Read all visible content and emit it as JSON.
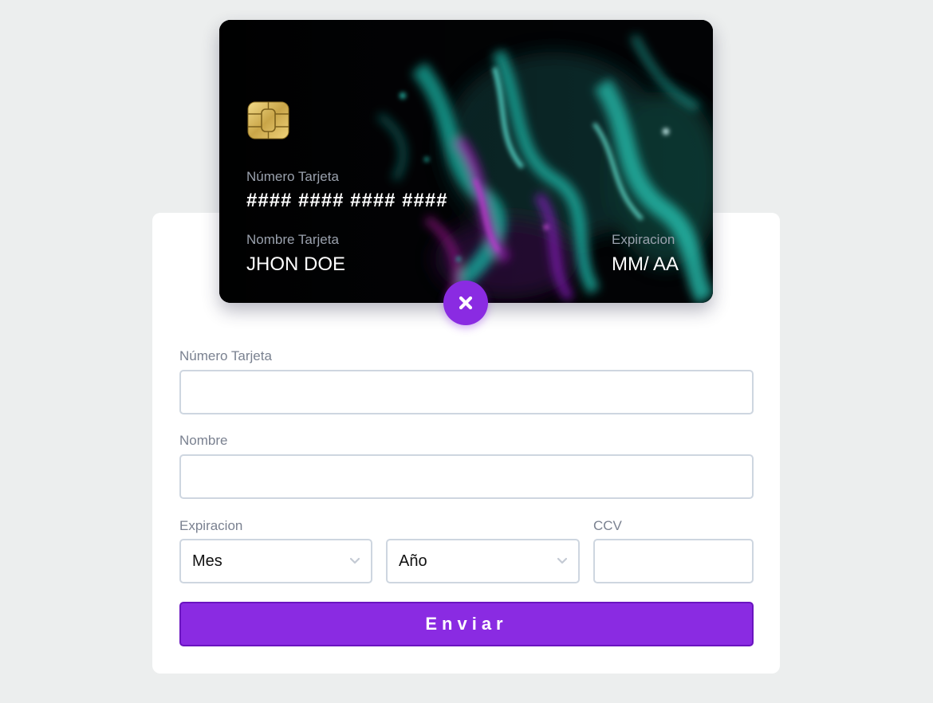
{
  "card": {
    "number_label": "Número Tarjeta",
    "number_value": "#### #### #### ####",
    "name_label": "Nombre Tarjeta",
    "name_value": "JHON DOE",
    "expiry_label": "Expiracion",
    "expiry_value": "MM/ AA"
  },
  "form": {
    "number_label": "Número Tarjeta",
    "number_value": "",
    "name_label": "Nombre",
    "name_value": "",
    "expiry_label": "Expiracion",
    "month_selected": "Mes",
    "year_selected": "Año",
    "ccv_label": "CCV",
    "ccv_value": "",
    "submit_label": "Enviar"
  },
  "icons": {
    "toggle": "close-icon",
    "chip": "chip-icon",
    "select_arrow": "chevron-down-icon"
  },
  "colors": {
    "accent": "#8a2be2",
    "background": "#eceeee",
    "card_background": "#020305",
    "input_border": "#ced6e0"
  }
}
